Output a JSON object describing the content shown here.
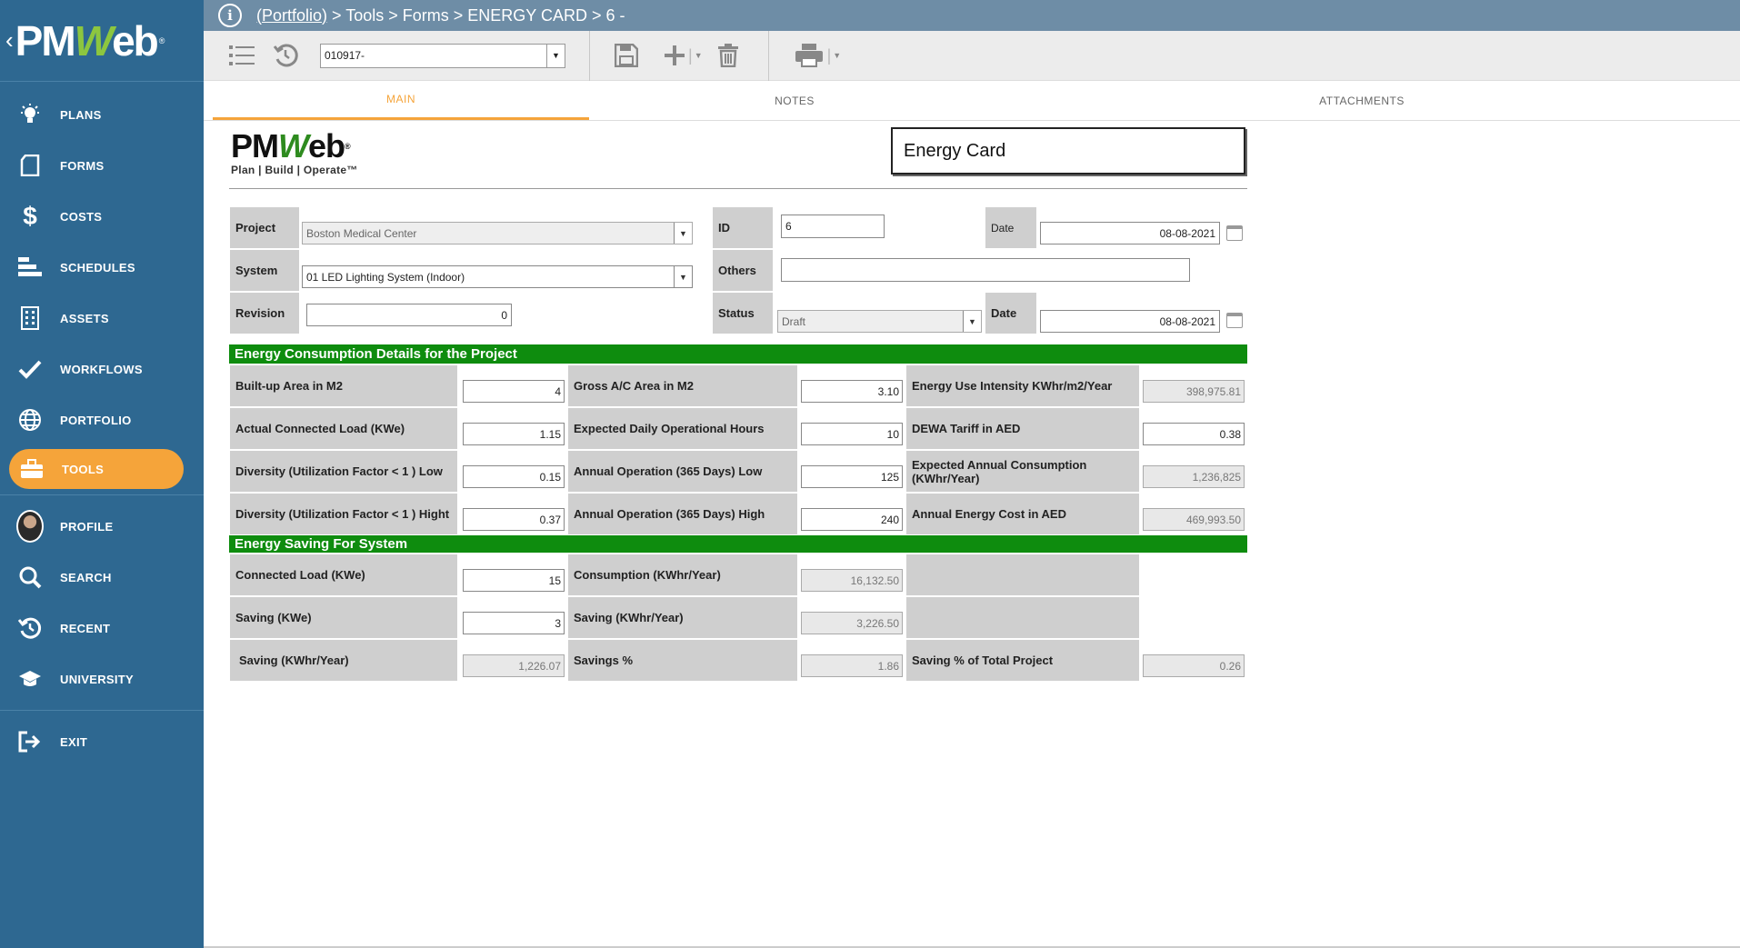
{
  "app": {
    "logo": "PMWeb"
  },
  "breadcrumb": {
    "portfolio": "(Portfolio)",
    "rest": "> Tools > Forms > ENERGY CARD > 6 -"
  },
  "sidebar": {
    "items": [
      {
        "label": "PLANS",
        "icon": "lightbulb-icon"
      },
      {
        "label": "FORMS",
        "icon": "document-icon"
      },
      {
        "label": "COSTS",
        "icon": "dollar-icon"
      },
      {
        "label": "SCHEDULES",
        "icon": "gantt-icon"
      },
      {
        "label": "ASSETS",
        "icon": "building-icon"
      },
      {
        "label": "WORKFLOWS",
        "icon": "checkmark-icon"
      },
      {
        "label": "PORTFOLIO",
        "icon": "globe-icon"
      },
      {
        "label": "TOOLS",
        "icon": "briefcase-icon",
        "active": true
      },
      {
        "label": "PROFILE",
        "icon": "avatar"
      },
      {
        "label": "SEARCH",
        "icon": "search-icon"
      },
      {
        "label": "RECENT",
        "icon": "history-icon"
      },
      {
        "label": "UNIVERSITY",
        "icon": "graduation-cap-icon"
      },
      {
        "label": "EXIT",
        "icon": "exit-icon"
      }
    ]
  },
  "toolbar": {
    "record_select": "010917-"
  },
  "tabs": [
    "MAIN",
    "NOTES",
    "ATTACHMENTS"
  ],
  "form": {
    "brand_title": "PMWeb",
    "brand_tagline": "Plan | Build | Operate™",
    "title": "Energy Card",
    "header": {
      "project_label": "Project",
      "project_value": "Boston Medical Center",
      "id_label": "ID",
      "id_value": "6",
      "date_label": "Date",
      "date_value": "08-08-2021",
      "system_label": "System",
      "system_value": "01 LED Lighting System (Indoor)",
      "others_label": "Others",
      "others_value": "",
      "revision_label": "Revision",
      "revision_value": "0",
      "status_label": "Status",
      "status_value": "Draft",
      "date2_label": "Date",
      "date2_value": "08-08-2021"
    },
    "section1": {
      "title": "Energy Consumption Details for the Project",
      "rows": [
        [
          {
            "label": "Built-up Area in M2",
            "value": "4"
          },
          {
            "label": "Gross A/C Area in M2",
            "value": "3.10"
          },
          {
            "label": "Energy Use Intensity KWhr/m2/Year",
            "value": "398,975.81"
          }
        ],
        [
          {
            "label": "Actual Connected Load (KWe)",
            "value": "1.15"
          },
          {
            "label": "Expected Daily Operational Hours",
            "value": "10"
          },
          {
            "label": "DEWA Tariff in AED",
            "value": "0.38"
          }
        ],
        [
          {
            "label": "Diversity (Utilization Factor < 1 ) Low",
            "value": "0.15"
          },
          {
            "label": "Annual Operation (365 Days) Low",
            "value": "125"
          },
          {
            "label": "Expected Annual Consumption (KWhr/Year)",
            "value": "1,236,825"
          }
        ],
        [
          {
            "label": "Diversity (Utilization Factor < 1 ) Hight",
            "value": "0.37"
          },
          {
            "label": "Annual Operation (365 Days) High",
            "value": "240"
          },
          {
            "label": "Annual Energy Cost in AED",
            "value": "469,993.50"
          }
        ]
      ]
    },
    "section2": {
      "title": "Energy Saving For System",
      "rows": [
        [
          {
            "label": "Connected Load (KWe)",
            "value": "15"
          },
          {
            "label": "Consumption (KWhr/Year)",
            "value": "16,132.50"
          },
          {
            "label": "",
            "value": ""
          }
        ],
        [
          {
            "label": "Saving (KWe)",
            "value": "3"
          },
          {
            "label": "Saving (KWhr/Year)",
            "value": "3,226.50"
          },
          {
            "label": "",
            "value": ""
          }
        ],
        [
          {
            "label": "Saving (KWhr/Year)",
            "value": "1,226.07"
          },
          {
            "label": "Savings %",
            "value": "1.86"
          },
          {
            "label": "Saving % of Total Project",
            "value": "0.26"
          }
        ]
      ]
    }
  },
  "colors": {
    "sidebar": "#2e6891",
    "accent": "#f5a43a",
    "section": "#0e8c0e"
  }
}
